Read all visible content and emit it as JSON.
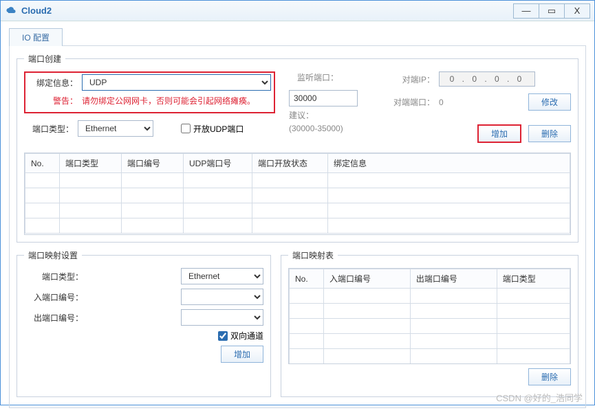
{
  "window": {
    "title": "Cloud2"
  },
  "tab": {
    "label": "IO 配置"
  },
  "create": {
    "legend": "端口创建",
    "bind_label": "绑定信息：",
    "bind_value": "UDP",
    "warn_label": "警告：",
    "warn_text": "请勿绑定公网网卡，否则可能会引起网络瘫痪。",
    "port_type_label": "端口类型：",
    "port_type_value": "Ethernet",
    "open_udp_label": "开放UDP端口",
    "listen_label": "监听端口：",
    "listen_value": "30000",
    "suggest_label": "建议：",
    "suggest_text": "(30000-35000)",
    "peer_ip_label": "对端IP：",
    "peer_ip_value": "0 . 0 . 0 . 0",
    "peer_port_label": "对端端口：",
    "peer_port_value": "0",
    "modify_btn": "修改",
    "add_btn": "增加",
    "del_btn": "删除",
    "cols": {
      "no": "No.",
      "ptype": "端口类型",
      "pno": "端口编号",
      "udpno": "UDP端口号",
      "openstate": "端口开放状态",
      "bindinfo": "绑定信息"
    }
  },
  "mapset": {
    "legend": "端口映射设置",
    "port_type_label": "端口类型：",
    "port_type_value": "Ethernet",
    "in_label": "入端口编号：",
    "out_label": "出端口编号：",
    "bidir_label": "双向通道",
    "add_btn": "增加"
  },
  "maptable": {
    "legend": "端口映射表",
    "cols": {
      "no": "No.",
      "inno": "入端口编号",
      "outno": "出端口编号",
      "ptype": "端口类型"
    },
    "del_btn": "删除"
  },
  "watermark": "CSDN @好的_浩同学"
}
